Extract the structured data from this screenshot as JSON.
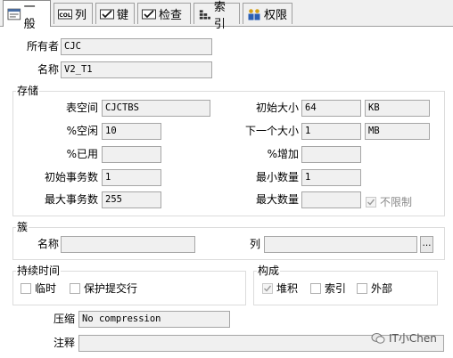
{
  "tabs": [
    {
      "label": "一般",
      "icon": "general-tab-icon"
    },
    {
      "label": "列",
      "icon": "columns-icon"
    },
    {
      "label": "键",
      "icon": "key-icon"
    },
    {
      "label": "检查",
      "icon": "check-icon"
    },
    {
      "label": "索引",
      "icon": "index-icon"
    },
    {
      "label": "权限",
      "icon": "users-icon"
    }
  ],
  "general": {
    "owner_label": "所有者",
    "owner_value": "CJC",
    "name_label": "名称",
    "name_value": "V2_T1"
  },
  "storage": {
    "title": "存储",
    "tablespace_label": "表空间",
    "tablespace_value": "CJCTBS",
    "pctfree_label": "%空闲",
    "pctfree_value": "10",
    "pctused_label": "%已用",
    "pctused_value": "",
    "initrans_label": "初始事务数",
    "initrans_value": "1",
    "maxtrans_label": "最大事务数",
    "maxtrans_value": "255",
    "initial_label": "初始大小",
    "initial_value": "64",
    "initial_unit": "KB",
    "next_label": "下一个大小",
    "next_value": "1",
    "next_unit": "MB",
    "pctincrease_label": "%增加",
    "pctincrease_value": "",
    "minext_label": "最小数量",
    "minext_value": "1",
    "maxext_label": "最大数量",
    "maxext_value": "",
    "unlimited_label": "不限制"
  },
  "cluster": {
    "title": "簇",
    "name_label": "名称",
    "name_value": "",
    "columns_label": "列",
    "columns_value": "",
    "browse_label": "..."
  },
  "duration": {
    "title": "持续时间",
    "temporary_label": "临时",
    "preserve_label": "保护提交行"
  },
  "organization": {
    "title": "构成",
    "heap_label": "堆积",
    "index_label": "索引",
    "external_label": "外部"
  },
  "compression": {
    "label": "压缩",
    "value": "No compression"
  },
  "comment": {
    "label": "注释",
    "value": ""
  },
  "watermark": {
    "text": "IT小Chen"
  }
}
